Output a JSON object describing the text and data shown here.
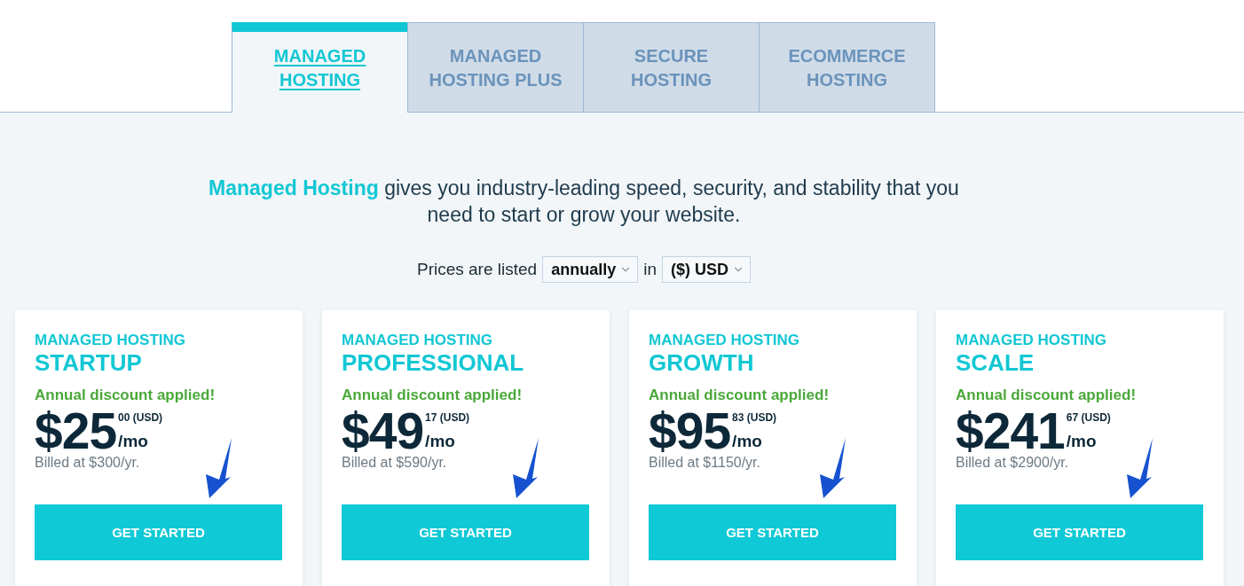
{
  "tabs": [
    {
      "label": "MANAGED HOSTING",
      "selected": true
    },
    {
      "label": "MANAGED HOSTING PLUS",
      "selected": false
    },
    {
      "label": "SECURE HOSTING",
      "selected": false
    },
    {
      "label": "ECOMMERCE HOSTING",
      "selected": false
    }
  ],
  "intro": "**Managed Hosting** gives you industry-leading speed, security, and stability that you need to start or grow your website.",
  "pricing_options": {
    "label": "Prices are listed",
    "billing_period": {
      "value": "annually"
    },
    "joiner": "in",
    "currency": {
      "value": "($) USD"
    }
  },
  "plans": [
    {
      "product": "MANAGED HOSTING",
      "tier": "STARTUP",
      "discount": "Annual discount applied!",
      "price": "$25",
      "cents": "00 (USD)",
      "period": "/mo",
      "billed": "Billed at $300/yr.",
      "button": "GET STARTED"
    },
    {
      "product": "MANAGED HOSTING",
      "tier": "PROFESSIONAL",
      "discount": "Annual discount applied!",
      "price": "$49",
      "cents": "17 (USD)",
      "period": "/mo",
      "billed": "Billed at $590/yr.",
      "button": "GET STARTED"
    },
    {
      "product": "MANAGED HOSTING",
      "tier": "GROWTH",
      "discount": "Annual discount applied!",
      "price": "$95",
      "cents": "83 (USD)",
      "period": "/mo",
      "billed": "Billed at $1150/yr.",
      "button": "GET STARTED"
    },
    {
      "product": "MANAGED HOSTING",
      "tier": "SCALE",
      "discount": "Annual discount applied!",
      "price": "$241",
      "cents": "67 (USD)",
      "period": "/mo",
      "billed": "Billed at $2900/yr.",
      "button": "GET STARTED"
    }
  ]
}
